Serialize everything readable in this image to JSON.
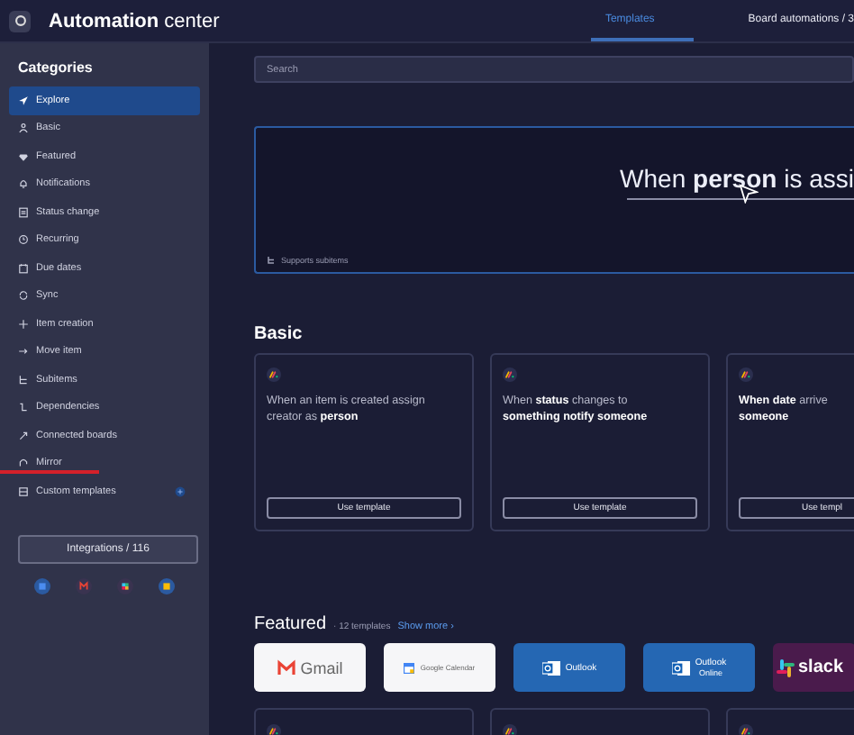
{
  "header": {
    "title": "**Automation** center"
  },
  "tabs": [
    {
      "label": "Templates",
      "selected": true
    },
    {
      "label": "Board automations / 3",
      "selected": false
    }
  ],
  "sidebar": {
    "title": "Categories",
    "items": [
      {
        "label": "Explore",
        "selected": true,
        "kind": "category"
      },
      {
        "label": "Basic",
        "selected": false,
        "kind": "category"
      },
      {
        "label": "Featured",
        "selected": false,
        "kind": "category"
      },
      {
        "label": "Notifications",
        "selected": false,
        "kind": "category"
      },
      {
        "label": "Status change",
        "selected": false,
        "kind": "category"
      },
      {
        "label": "Recurring",
        "selected": false,
        "kind": "category"
      },
      {
        "label": "Due dates",
        "selected": false,
        "kind": "category"
      },
      {
        "label": "Sync",
        "selected": false,
        "kind": "category"
      },
      {
        "label": "Item creation",
        "selected": false,
        "kind": "category"
      },
      {
        "label": "Move item",
        "selected": false,
        "kind": "category"
      },
      {
        "label": "Subitems",
        "selected": false,
        "kind": "category"
      },
      {
        "label": "Dependencies",
        "selected": false,
        "kind": "category"
      },
      {
        "label": "Connected boards",
        "selected": false,
        "kind": "category"
      },
      {
        "label": "Mirror",
        "selected": false,
        "kind": "category"
      },
      {
        "label": "Custom templates",
        "selected": false,
        "kind": "custom"
      }
    ],
    "integrations_button": "Integrations / 116"
  },
  "search": {
    "placeholder": "Search"
  },
  "hero": {
    "headline": "When **person** is assi",
    "note": "Supports subitems"
  },
  "basic": {
    "title": "Basic",
    "cards": [
      {
        "lines": [
          "When an item is created assign",
          "creator as **person**"
        ],
        "button": "Use template"
      },
      {
        "lines": [
          "When **status** changes to",
          "**something notify someone**"
        ],
        "button": "Use template"
      },
      {
        "lines": [
          "**When date** arrive",
          "**someone**"
        ],
        "button": "Use templ"
      }
    ]
  },
  "featured": {
    "title": "Featured",
    "count": "· 12 templates",
    "link": "Show more ›",
    "apps": [
      {
        "name": "Gmail",
        "kind": "gmail"
      },
      {
        "name": "Google Calendar",
        "kind": "gcal"
      },
      {
        "name": "Outlook",
        "kind": "outlook"
      },
      {
        "name": "Outlook",
        "sub": "Online",
        "kind": "outlook"
      },
      {
        "name": "slack",
        "kind": "slack"
      }
    ],
    "cards": [
      {
        "kind": "template"
      },
      {
        "kind": "template"
      },
      {
        "kind": "template"
      }
    ]
  }
}
